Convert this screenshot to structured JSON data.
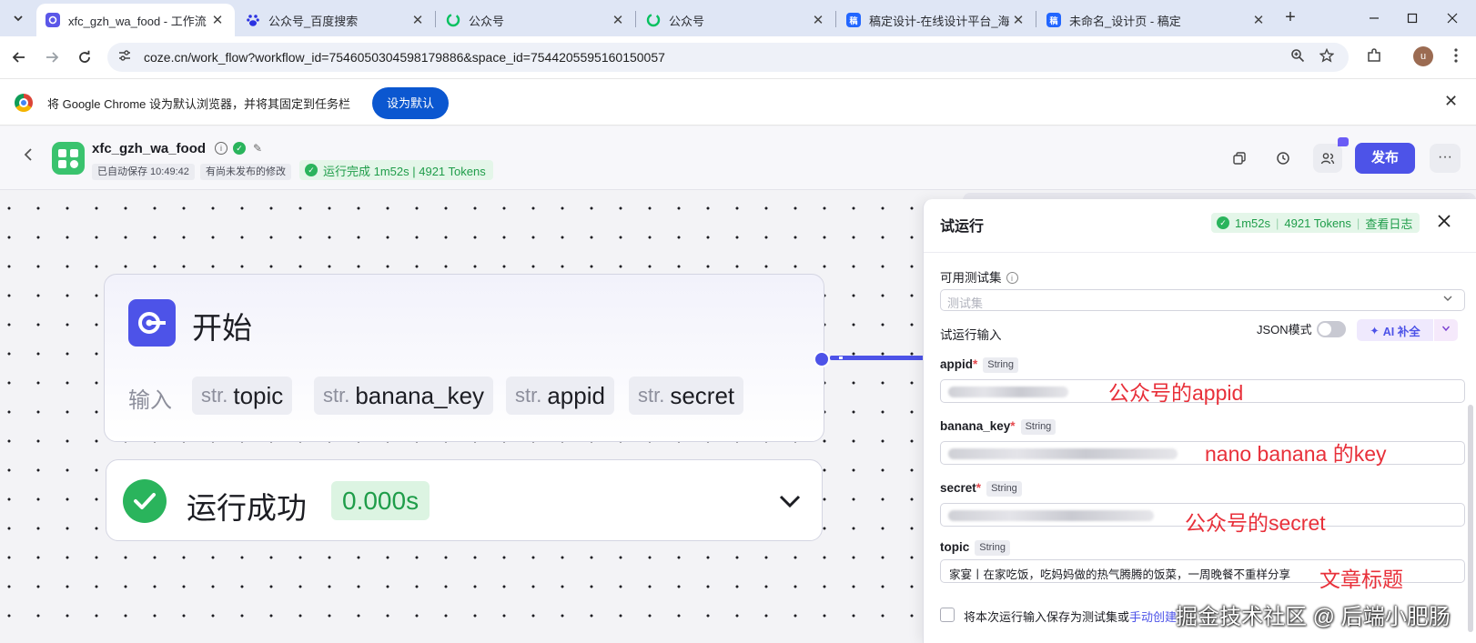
{
  "browser": {
    "tabs": [
      {
        "title": "xfc_gzh_wa_food - 工作流 - 扣",
        "icon": "coze-icon",
        "icon_color": "#5b57e8",
        "active": true
      },
      {
        "title": "公众号_百度搜索",
        "icon": "baidu-icon",
        "icon_color": "#2b32e1",
        "active": false
      },
      {
        "title": "公众号",
        "icon": "wechat-official-icon",
        "icon_color": "#07c160",
        "active": false
      },
      {
        "title": "公众号",
        "icon": "wechat-official-icon",
        "icon_color": "#07c160",
        "active": false
      },
      {
        "title": "稿定设计-在线设计平台_海报",
        "icon": "gaoding-icon",
        "icon_color": "#2266ff",
        "active": false
      },
      {
        "title": "未命名_设计页 - 稿定",
        "icon": "gaoding-icon",
        "icon_color": "#2266ff",
        "active": false
      }
    ],
    "favicon_glyph": "稿",
    "url": "coze.cn/work_flow?workflow_id=7546050304598179886&space_id=7544205595160150057",
    "profile_initial": "u",
    "infobar": {
      "message": "将 Google Chrome 设为默认浏览器，并将其固定到任务栏",
      "button": "设为默认"
    }
  },
  "header": {
    "workflow_name": "xfc_gzh_wa_food",
    "autosave": "已自动保存 10:49:42",
    "unpublished": "有尚未发布的修改",
    "run_status": "运行完成 1m52s | 4921 Tokens",
    "publish_label": "发布"
  },
  "canvas": {
    "start_node": {
      "title": "开始",
      "input_label": "输入",
      "type_prefix": "str.",
      "params": [
        "topic",
        "banana_key",
        "appid",
        "secret"
      ]
    },
    "result_node": {
      "title": "运行成功",
      "duration": "0.000s"
    }
  },
  "panel": {
    "title": "试运行",
    "status": {
      "time": "1m52s",
      "tokens": "4921 Tokens",
      "log_link": "查看日志"
    },
    "testset_label": "可用测试集",
    "testset_placeholder": "测试集",
    "input_section": "试运行输入",
    "json_mode": "JSON模式",
    "ai_fill": "AI 补全",
    "fields": [
      {
        "name": "appid",
        "required": true,
        "type": "String",
        "value": "",
        "annotation": "公众号的appid"
      },
      {
        "name": "banana_key",
        "required": true,
        "type": "String",
        "value": "",
        "annotation": "nano banana 的key"
      },
      {
        "name": "secret",
        "required": true,
        "type": "String",
        "value": "",
        "annotation": "公众号的secret"
      },
      {
        "name": "topic",
        "required": false,
        "type": "String",
        "value": "家宴丨在家吃饭，吃妈妈做的热气腾腾的饭菜，一周晚餐不重样分享",
        "annotation": "文章标题"
      }
    ],
    "save_checkbox": "将本次运行输入保存为测试集或",
    "save_link": "手动创建"
  },
  "watermark": "掘金技术社区 @ 后端小肥肠",
  "colors": {
    "accent": "#4d53e8",
    "success": "#2ab45c",
    "annotation": "#e8303a"
  }
}
